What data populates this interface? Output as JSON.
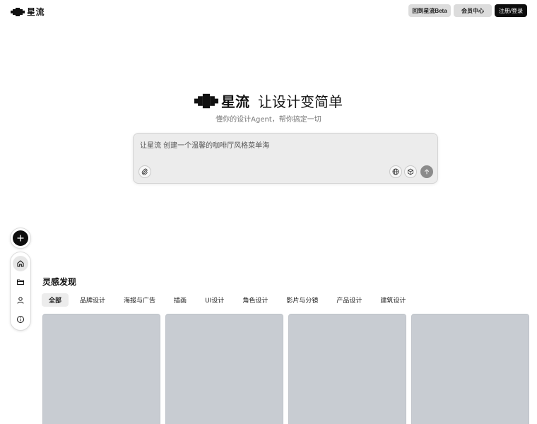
{
  "header": {
    "brand": "星流",
    "beta_button": "回到星流Beta",
    "member_button": "会员中心",
    "login_button": "注册/登录"
  },
  "hero": {
    "brand": "星流",
    "slogan": "让设计变简单",
    "subtitle": "懂你的设计Agent，帮你搞定一切"
  },
  "prompt": {
    "placeholder": "让星流 创建一个温馨的咖啡厅风格菜单海"
  },
  "inspiration": {
    "title": "灵感发现",
    "tabs": [
      "全部",
      "品牌设计",
      "海报与广告",
      "插画",
      "UI设计",
      "角色设计",
      "影片与分镜",
      "产品设计",
      "建筑设计"
    ],
    "active_tab": "全部"
  },
  "icons": {
    "logo": "pixel-cloud-logo-icon",
    "attach": "paperclip-icon",
    "globe": "globe-icon",
    "cube": "cube-icon",
    "send": "arrow-up-icon",
    "new": "plus-icon",
    "home": "home-icon",
    "folder": "folder-icon",
    "user": "user-icon",
    "info": "info-icon"
  },
  "colors": {
    "primary_dark": "#0d0d0d",
    "secondary_button": "#dcdcdc",
    "card_placeholder": "#c8ccd2"
  }
}
